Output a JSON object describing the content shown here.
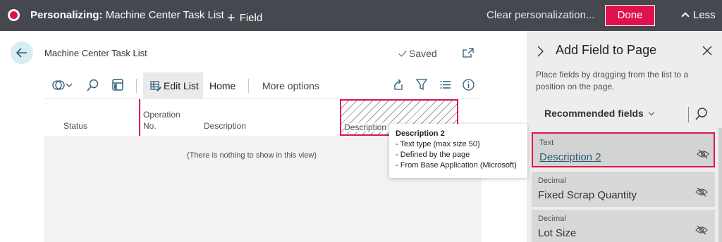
{
  "topbar": {
    "personalizing_label": "Personalizing:",
    "page_name": "Machine Center Task List",
    "add_field_label": "Field",
    "clear_label": "Clear personalization...",
    "done_label": "Done",
    "less_label": "Less"
  },
  "page": {
    "title": "Machine Center Task List",
    "saved_label": "Saved",
    "action_bar": {
      "edit_list_label": "Edit List",
      "home_label": "Home",
      "more_options_label": "More options"
    },
    "columns": {
      "status": "Status",
      "operation_no_1": "Operation",
      "operation_no_2": "No.",
      "description": "Description",
      "description_2": "Description 2"
    },
    "empty_message": "(There is nothing to show in this view)"
  },
  "tooltip": {
    "title": "Description 2",
    "lines": [
      "- Text type (max size 50)",
      "- Defined by the page",
      "- From Base Application (Microsoft)"
    ]
  },
  "panel": {
    "title": "Add Field to Page",
    "description": "Place fields by dragging from the list to a position on the page.",
    "filter_label": "Recommended fields",
    "fields": [
      {
        "type": "Text",
        "name": "Description 2"
      },
      {
        "type": "Decimal",
        "name": "Fixed Scrap Quantity"
      },
      {
        "type": "Decimal",
        "name": "Lot Size"
      }
    ]
  },
  "colors": {
    "accent": "#e0124e",
    "topbar_bg": "#45484f",
    "panel_bg": "#ededed"
  }
}
